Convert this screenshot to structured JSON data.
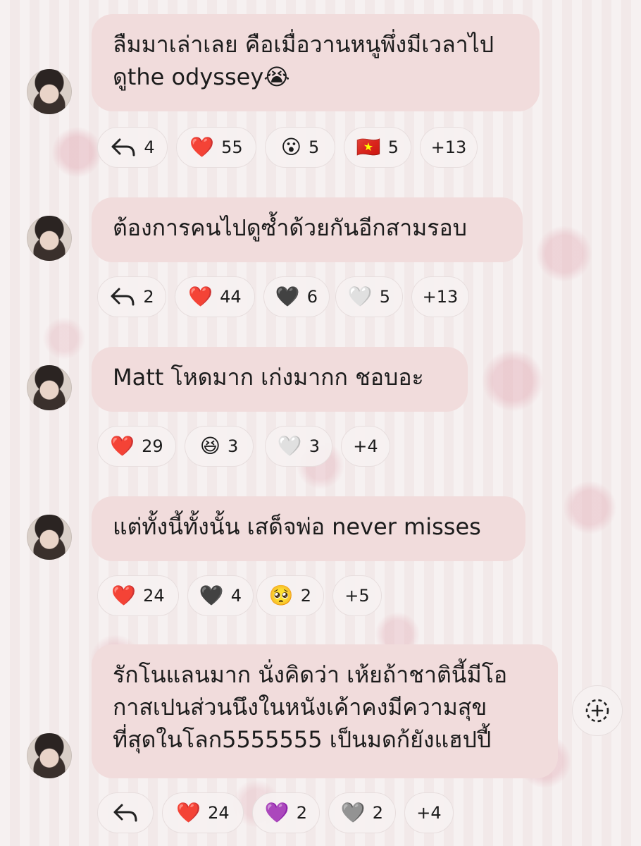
{
  "messages": [
    {
      "lines": [
        "ลืมมาเล่าเลย คือเมื่อวานหนูพึ่งมีเวลาไป",
        "ดูthe odyssey😭"
      ],
      "reply_count": "4",
      "reactions": [
        {
          "emoji": "❤️",
          "count": "55"
        },
        {
          "emoji": "😮",
          "count": "5"
        },
        {
          "emoji": "🇻🇳",
          "count": "5"
        }
      ],
      "more": "+13"
    },
    {
      "lines": [
        "ต้องการคนไปดูซ้ำด้วยกันอีกสามรอบ"
      ],
      "reply_count": "2",
      "reactions": [
        {
          "emoji": "❤️",
          "count": "44"
        },
        {
          "emoji": "🖤",
          "count": "6"
        },
        {
          "emoji": "🤍",
          "count": "5"
        }
      ],
      "more": "+13"
    },
    {
      "lines": [
        "Matt โหดมาก เก่งมากก ชอบอะ"
      ],
      "reactions": [
        {
          "emoji": "❤️",
          "count": "29"
        },
        {
          "emoji": "😆",
          "count": "3"
        },
        {
          "emoji": "🤍",
          "count": "3"
        }
      ],
      "more": "+4"
    },
    {
      "lines": [
        "แต่ทั้งนี้ทั้งนั้น เสด็จพ่อ never misses"
      ],
      "reactions": [
        {
          "emoji": "❤️",
          "count": "24"
        },
        {
          "emoji": "🖤",
          "count": "4"
        },
        {
          "emoji": "🥺",
          "count": "2"
        }
      ],
      "more": "+5"
    },
    {
      "lines": [
        "รักโนแลนมาก นั่งคิดว่า เห้ยถ้าชาตินี้มีโอ",
        "กาสเปนส่วนนึงในหนังเค้าคงมีความสุข",
        "ที่สุดในโลก5555555 เป็นมดก้ยังแฮปปี้"
      ],
      "reactions": [
        {
          "emoji": "❤️",
          "count": "24"
        },
        {
          "emoji": "💜",
          "count": "2"
        },
        {
          "emoji": "🩶",
          "count": "2"
        }
      ],
      "more": "+4"
    }
  ],
  "colors": {
    "bubble": "#f1dcdc",
    "chip": "#f6f1f1"
  }
}
